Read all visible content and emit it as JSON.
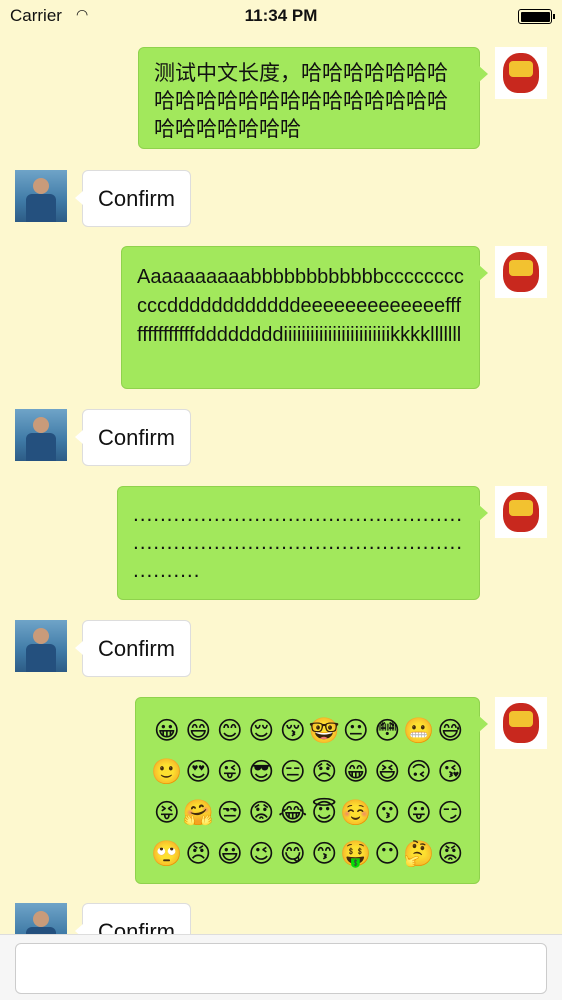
{
  "status_bar": {
    "carrier": "Carrier",
    "time": "11:34 PM"
  },
  "messages": [
    {
      "from": "me",
      "text": "测试中文长度，哈哈哈哈哈哈哈哈哈哈哈哈哈哈哈哈哈哈哈哈哈哈哈哈哈哈哈哈"
    },
    {
      "from": "other",
      "text": "Confirm"
    },
    {
      "from": "me",
      "text": "Aaaaaaaaaabbbbbbbbbbbbcccccccccccddddddddddddeeeeeeeeeeeeeffffffffffffffddddddddiiiiiiiiiiiiiiiiiiiiiiiikkkklllllll"
    },
    {
      "from": "other",
      "text": "Confirm"
    },
    {
      "from": "me",
      "text": "............................................................................................................"
    },
    {
      "from": "other",
      "text": "Confirm"
    },
    {
      "from": "me",
      "emojis": [
        "😀",
        "😄",
        "😊",
        "😌",
        "😚",
        "🤓",
        "😐",
        "😳",
        "😬",
        "😅",
        "🙂",
        "😍",
        "😜",
        "😎",
        "😑",
        "😞",
        "😁",
        "😆",
        "🙃",
        "😘",
        "😝",
        "🤗",
        "😒",
        "😟",
        "😂",
        "😇",
        "☺️",
        "😗",
        "😛",
        "😏",
        "🙄",
        "😠",
        "😃",
        "😉",
        "😋",
        "😙",
        "🤑",
        "😶",
        "🤔",
        "😡"
      ]
    },
    {
      "from": "other",
      "text": "Confirm"
    }
  ],
  "input": {
    "value": ""
  }
}
